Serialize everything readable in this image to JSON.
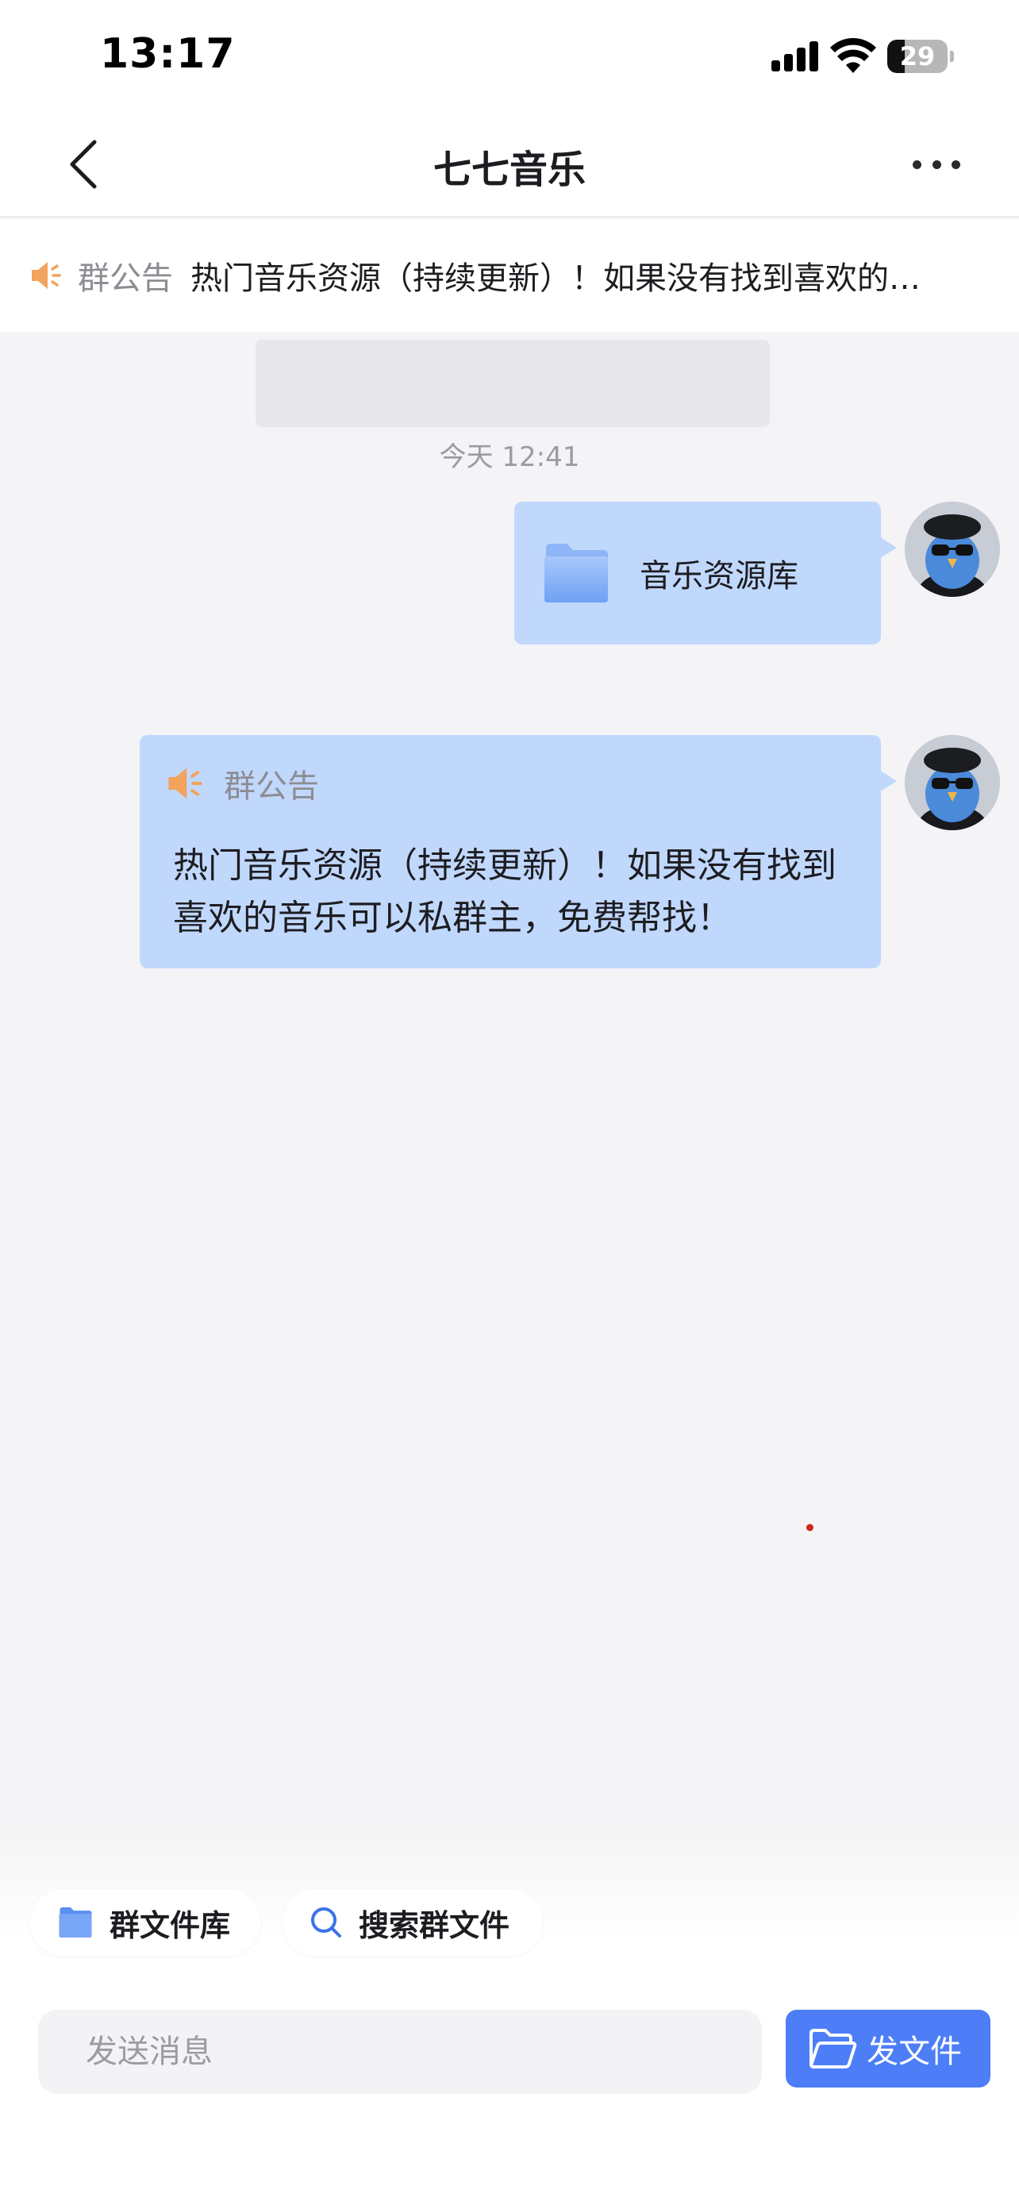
{
  "status_bar": {
    "time": "13:17",
    "battery": "29",
    "battery_level": 0.29
  },
  "nav": {
    "title": "七七音乐"
  },
  "announcement_bar": {
    "label": "群公告",
    "text": "热门音乐资源（持续更新）！如果没有找到喜欢的…"
  },
  "chat": {
    "timestamp": "今天 12:41",
    "messages": [
      {
        "type": "file",
        "name": "音乐资源库"
      },
      {
        "type": "notice",
        "label": "群公告",
        "text": "热门音乐资源（持续更新）！如果没有找到喜欢的音乐可以私群主，免费帮找！"
      }
    ]
  },
  "quick_actions": {
    "file_library": "群文件库",
    "search_files": "搜索群文件"
  },
  "composer": {
    "placeholder": "发送消息",
    "send_file_label": "发文件"
  },
  "colors": {
    "accent": "#4d7ef7",
    "bubble": "#c1d8fd",
    "speaker_icon": "#f2a35e"
  }
}
